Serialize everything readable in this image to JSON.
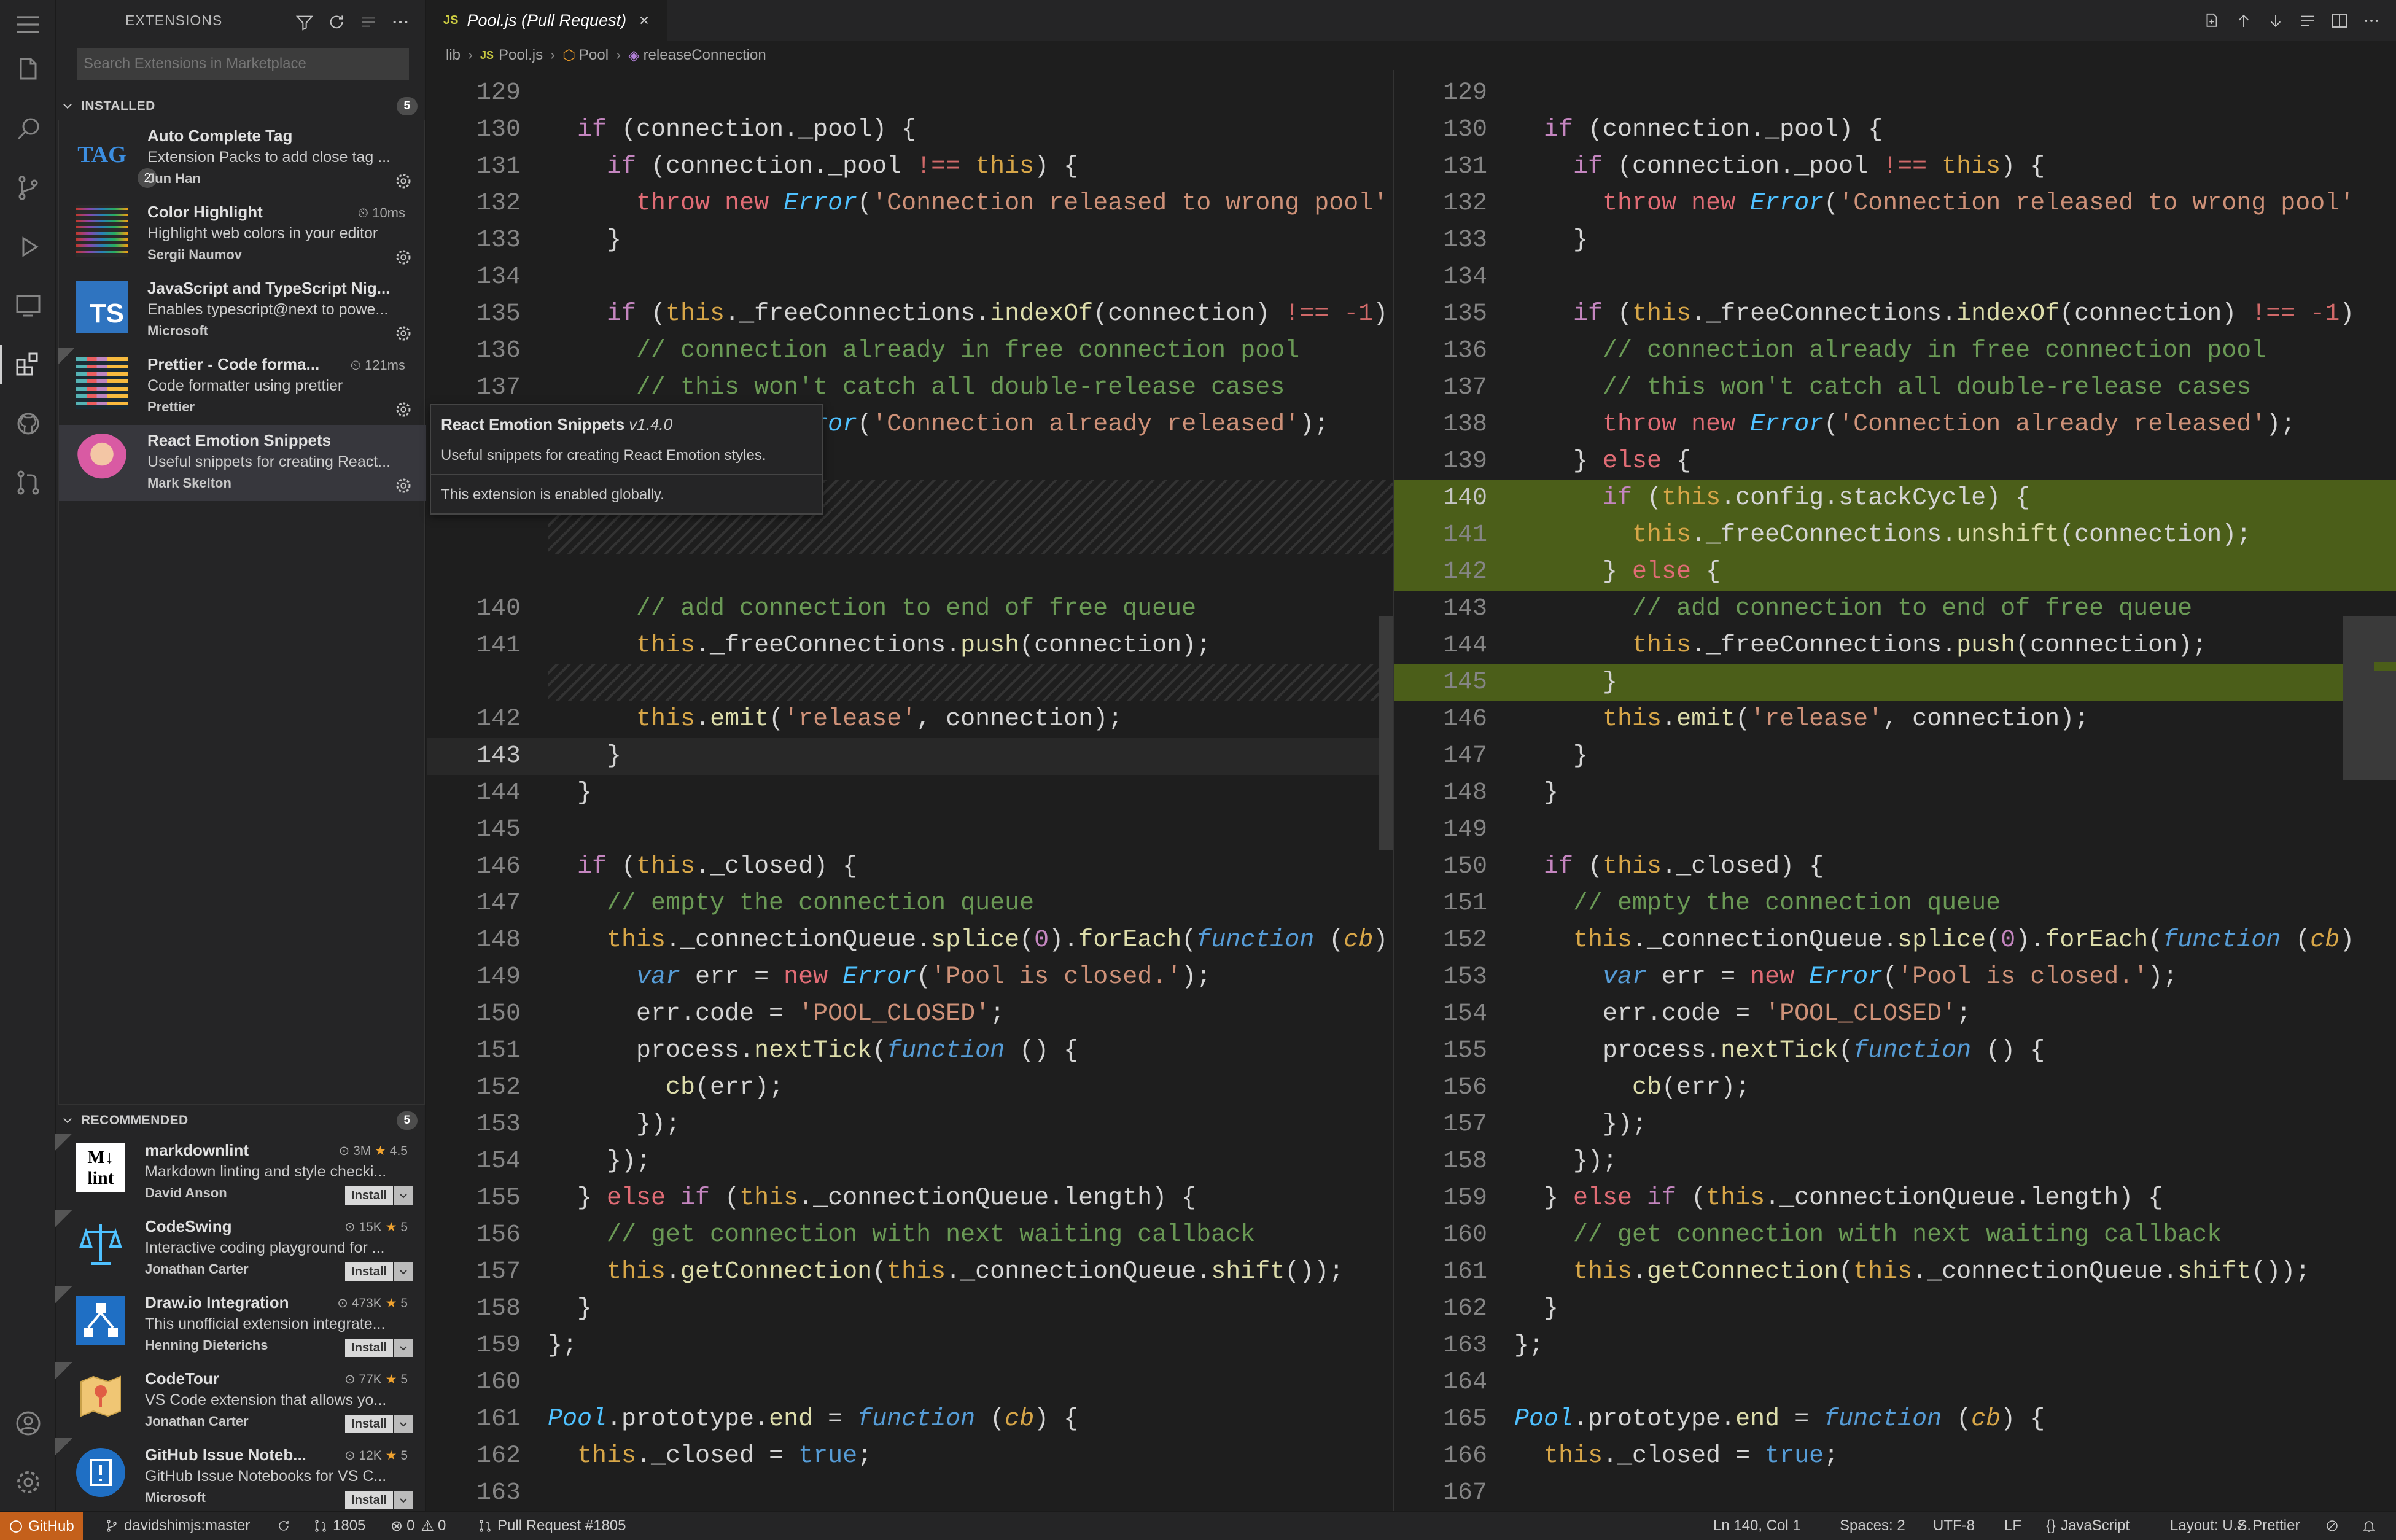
{
  "sidebar": {
    "title": "EXTENSIONS",
    "search_placeholder": "Search Extensions in Marketplace",
    "installed": {
      "label": "INSTALLED",
      "count": "5",
      "items": [
        {
          "name": "Auto Complete Tag",
          "desc": "Extension Packs to add close tag ...",
          "author": "Jun Han",
          "time": "",
          "badge": "2",
          "icon_text": "TAG"
        },
        {
          "name": "Color Highlight",
          "desc": "Highlight web colors in your editor",
          "author": "Sergii Naumov",
          "time": "10ms"
        },
        {
          "name": "JavaScript and TypeScript Nig...",
          "desc": "Enables typescript@next to powe...",
          "author": "Microsoft",
          "time": "",
          "icon_text": "TS"
        },
        {
          "name": "Prettier - Code forma...",
          "desc": "Code formatter using prettier",
          "author": "Prettier",
          "time": "121ms"
        },
        {
          "name": "React Emotion Snippets",
          "desc": "Useful snippets for creating React...",
          "author": "Mark Skelton",
          "time": ""
        }
      ]
    },
    "recommended": {
      "label": "RECOMMENDED",
      "count": "5",
      "items": [
        {
          "name": "markdownlint",
          "desc": "Markdown linting and style checki...",
          "author": "David Anson",
          "downloads": "3M",
          "rating": "4.5",
          "install": "Install"
        },
        {
          "name": "CodeSwing",
          "desc": "Interactive coding playground for ...",
          "author": "Jonathan Carter",
          "downloads": "15K",
          "rating": "5",
          "install": "Install"
        },
        {
          "name": "Draw.io Integration",
          "desc": "This unofficial extension integrate...",
          "author": "Henning Dieterichs",
          "downloads": "473K",
          "rating": "5",
          "install": "Install"
        },
        {
          "name": "CodeTour",
          "desc": "VS Code extension that allows yo...",
          "author": "Jonathan Carter",
          "downloads": "77K",
          "rating": "5",
          "install": "Install"
        },
        {
          "name": "GitHub Issue Noteb...",
          "desc": "GitHub Issue Notebooks for VS C...",
          "author": "Microsoft",
          "downloads": "12K",
          "rating": "5",
          "install": "Install"
        }
      ]
    }
  },
  "tooltip": {
    "name": "React Emotion Snippets",
    "version": "v1.4.0",
    "desc": "Useful snippets for creating React Emotion styles.",
    "status": "This extension is enabled globally."
  },
  "editor": {
    "tab_title": "Pool.js (Pull Request)",
    "tab_lang": "JS",
    "breadcrumb": [
      "lib",
      "Pool.js",
      "Pool",
      "releaseConnection"
    ]
  },
  "left_lines": [
    "129",
    "130",
    "131",
    "132",
    "133",
    "134",
    "135",
    "136",
    "137",
    "",
    "",
    "",
    "140",
    "141",
    "",
    "142",
    "143",
    "144",
    "145",
    "146",
    "147",
    "148",
    "149",
    "150",
    "151",
    "152",
    "153",
    "154",
    "155",
    "156",
    "157",
    "158",
    "159",
    "160",
    "161",
    "162",
    "163"
  ],
  "right_lines": [
    "129",
    "130",
    "131",
    "132",
    "133",
    "134",
    "135",
    "136",
    "137",
    "138",
    "139",
    "140",
    "141",
    "142",
    "143",
    "144",
    "145",
    "146",
    "147",
    "148",
    "149",
    "150",
    "151",
    "152",
    "153",
    "154",
    "155",
    "156",
    "157",
    "158",
    "159",
    "160",
    "161",
    "162",
    "163",
    "164",
    "165",
    "166",
    "167"
  ],
  "status": {
    "github": "GitHub",
    "branch": "davidshimjs:master",
    "pr_count": "1805",
    "errors": "0",
    "warnings": "0",
    "pr": "Pull Request #1805",
    "position": "Ln 140, Col 1",
    "spaces": "Spaces: 2",
    "encoding": "UTF-8",
    "eol": "LF",
    "lang": "JavaScript",
    "layout": "Layout: U.S.",
    "formatter": "Prettier"
  },
  "colors": {
    "accent": "#c4601b",
    "added": "#4b5e19"
  }
}
